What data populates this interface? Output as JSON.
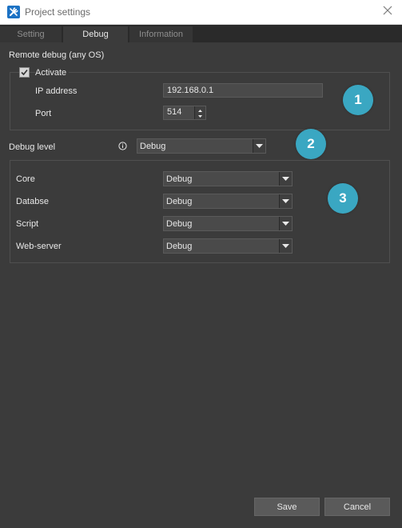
{
  "window": {
    "title": "Project settings",
    "app_icon": "tools-icon",
    "close_icon": "close-icon"
  },
  "tabs": [
    {
      "label": "Setting",
      "active": false
    },
    {
      "label": "Debug",
      "active": true
    },
    {
      "label": "Information",
      "active": false
    }
  ],
  "remote_debug": {
    "section_label": "Remote debug (any OS)",
    "activate_label": "Activate",
    "activate_checked": true,
    "ip_label": "IP address",
    "ip_value": "192.168.0.1",
    "port_label": "Port",
    "port_value": "514"
  },
  "debug_level": {
    "label": "Debug level",
    "value": "Debug"
  },
  "modules": [
    {
      "label": "Core",
      "value": "Debug"
    },
    {
      "label": "Databse",
      "value": "Debug"
    },
    {
      "label": "Script",
      "value": "Debug"
    },
    {
      "label": "Web-server",
      "value": "Debug"
    }
  ],
  "badges": [
    "1",
    "2",
    "3"
  ],
  "footer": {
    "save_label": "Save",
    "cancel_label": "Cancel"
  },
  "colors": {
    "background": "#3b3b3b",
    "badge": "#3aa7c2",
    "button": "#5a5a5a",
    "titlebar": "#ffffff"
  }
}
